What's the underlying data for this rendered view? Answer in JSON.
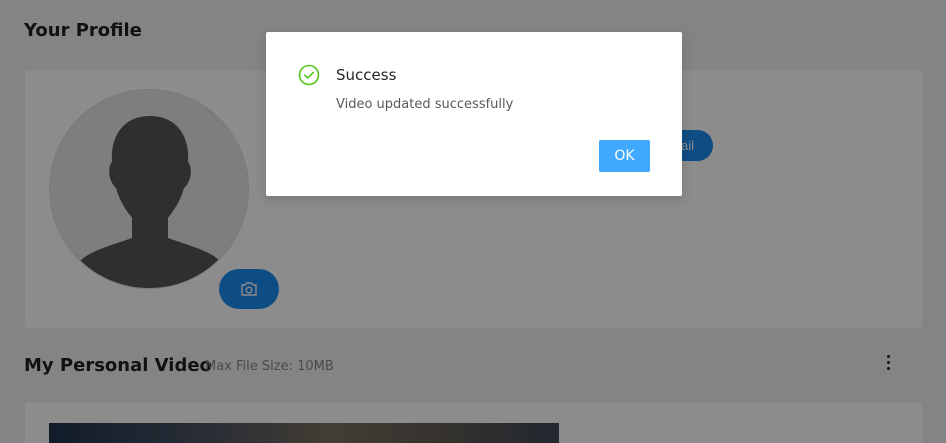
{
  "profile": {
    "title": "Your Profile",
    "email_button_label": "ail",
    "camera_icon": "camera-icon",
    "avatar_icon": "user-silhouette-icon"
  },
  "video": {
    "title": "My Personal Video",
    "max_size": "Max File Size: 10MB",
    "menu_icon": "kebab-menu-icon"
  },
  "modal": {
    "title": "Success",
    "message": "Video updated successfully",
    "ok_label": "OK",
    "icon": "check-circle-icon",
    "icon_color": "#52c41a",
    "button_color": "#40a9ff"
  },
  "colors": {
    "primary": "#1a8af0",
    "overlay": "rgba(0,0,0,0.45)"
  }
}
